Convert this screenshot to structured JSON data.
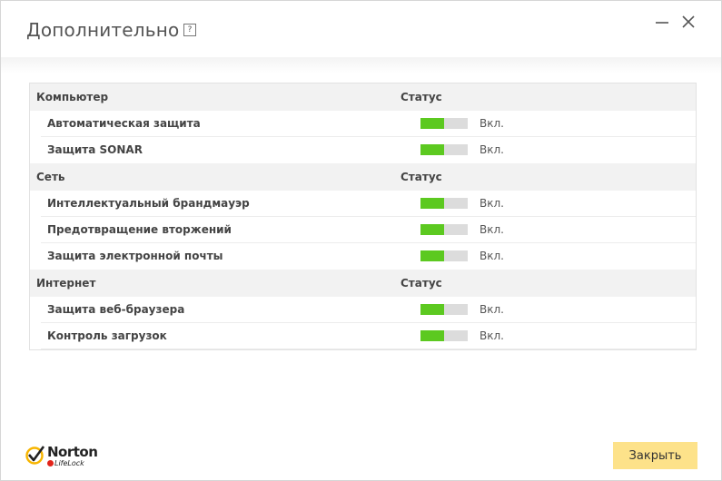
{
  "window": {
    "title": "Дополнительно",
    "help_label": "?",
    "minimize_icon": "minimize-icon",
    "close_icon": "close-icon"
  },
  "sections": [
    {
      "name": "Компьютер",
      "status_header": "Статус",
      "items": [
        {
          "label": "Автоматическая защита",
          "status": "Вкл.",
          "enabled": true
        },
        {
          "label": "Защита SONAR",
          "status": "Вкл.",
          "enabled": true
        }
      ]
    },
    {
      "name": "Сеть",
      "status_header": "Статус",
      "items": [
        {
          "label": "Интеллектуальный брандмауэр",
          "status": "Вкл.",
          "enabled": true
        },
        {
          "label": "Предотвращение вторжений",
          "status": "Вкл.",
          "enabled": true
        },
        {
          "label": "Защита электронной почты",
          "status": "Вкл.",
          "enabled": true
        }
      ]
    },
    {
      "name": "Интернет",
      "status_header": "Статус",
      "items": [
        {
          "label": "Защита веб-браузера",
          "status": "Вкл.",
          "enabled": true
        },
        {
          "label": "Контроль загрузок",
          "status": "Вкл.",
          "enabled": true
        }
      ]
    }
  ],
  "toggle": {
    "on_fraction": 0.5,
    "on_color": "#5cc920",
    "off_color": "#dcdcdc"
  },
  "footer": {
    "logo_text": "Norton",
    "logo_subtext": "LifeLock",
    "close_button_label": "Закрыть",
    "close_button_color": "#fde28a"
  }
}
